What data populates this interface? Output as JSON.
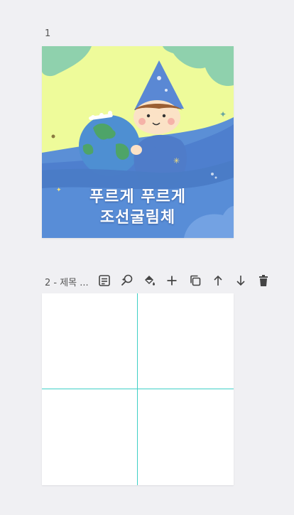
{
  "pages": [
    {
      "label": "1",
      "title_lines": [
        "푸르게 푸르게",
        "조선굴림체"
      ]
    },
    {
      "label": "2 - 제목 ..."
    }
  ],
  "toolbar": {
    "icons": [
      "note-icon",
      "magic-search-icon",
      "paint-bucket-icon",
      "plus-icon",
      "duplicate-icon",
      "arrow-up-icon",
      "arrow-down-icon",
      "trash-icon"
    ]
  },
  "colors": {
    "background": "#f0f0f3",
    "guide": "#3fd0c6",
    "illustration_sky": "#eefb9a",
    "illustration_blue": "#4e7fce"
  }
}
